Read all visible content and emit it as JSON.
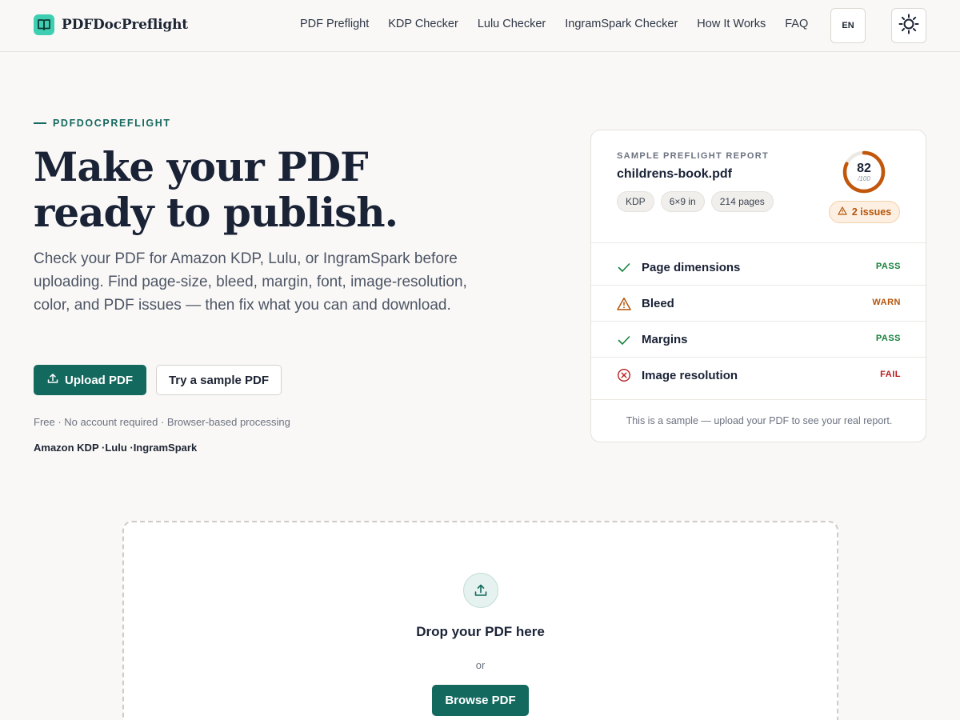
{
  "header": {
    "logo_text": "PDFDocPreflight",
    "nav": [
      "PDF Preflight",
      "KDP Checker",
      "Lulu Checker",
      "IngramSpark Checker",
      "How It Works",
      "FAQ"
    ],
    "lang_label": "EN"
  },
  "hero": {
    "eyebrow": "PDFDOCPREFLIGHT",
    "headline_line1": "Make your PDF",
    "headline_line2": "ready to publish.",
    "subtext": "Check your PDF for Amazon KDP, Lulu, or IngramSpark before uploading. Find page-size, bleed, margin, font, image-resolution, color, and PDF issues — then fix what you can and download.",
    "upload_label": "Upload PDF",
    "sample_label": "Try a sample PDF",
    "meta": "Free · No account required · Browser-based processing",
    "platforms": "Amazon KDP ·Lulu ·IngramSpark"
  },
  "report": {
    "label": "SAMPLE PREFLIGHT REPORT",
    "filename": "childrens-book.pdf",
    "chips": [
      "KDP",
      "6×9 in",
      "214 pages"
    ],
    "score": "82",
    "score_max": "/100",
    "issues": "2 issues",
    "checks": [
      {
        "name": "Page dimensions",
        "status": "PASS",
        "kind": "pass"
      },
      {
        "name": "Bleed",
        "status": "WARN",
        "kind": "warn"
      },
      {
        "name": "Margins",
        "status": "PASS",
        "kind": "pass"
      },
      {
        "name": "Image resolution",
        "status": "FAIL",
        "kind": "fail"
      }
    ],
    "footer": "This is a sample — upload your PDF to see your real report.",
    "colors": {
      "pass": "#16803c",
      "warn": "#b4540a",
      "fail": "#b91c1c",
      "ring": "#c2570c"
    }
  },
  "dropzone": {
    "title": "Drop your PDF here",
    "or": "or",
    "browse_label": "Browse PDF"
  }
}
